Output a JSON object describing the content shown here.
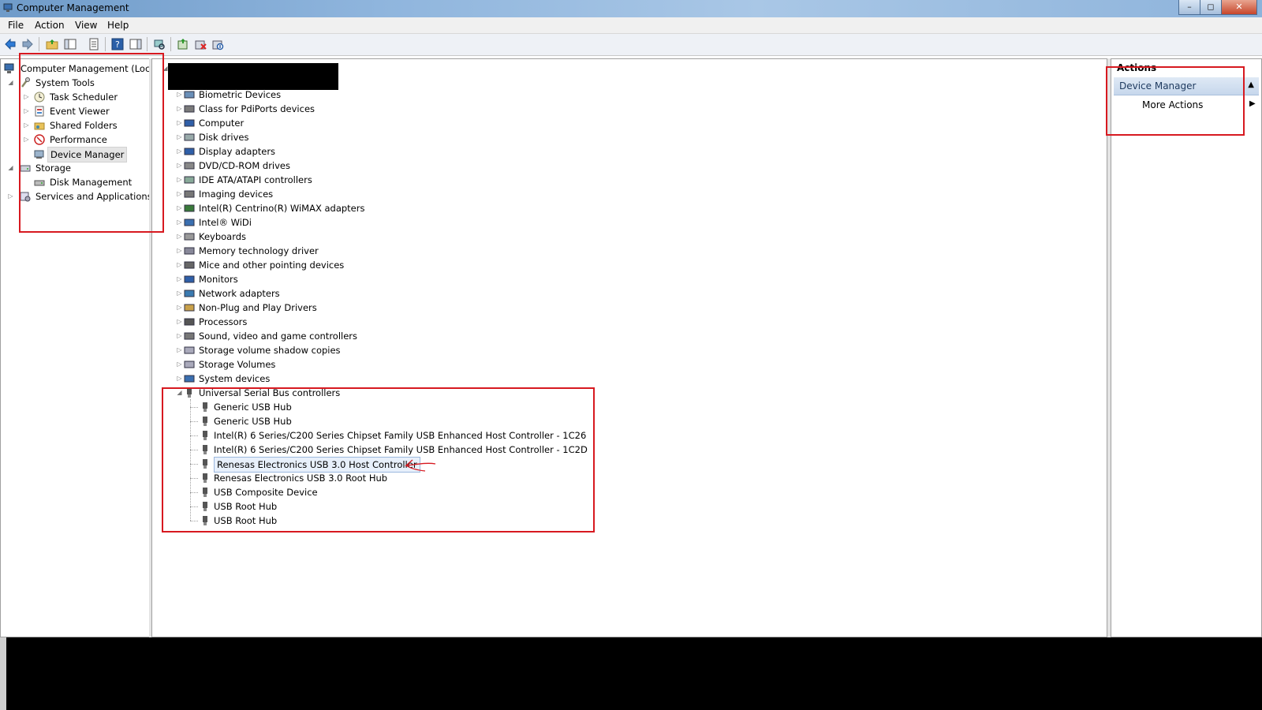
{
  "window": {
    "title": "Computer Management",
    "min": "–",
    "max": "◻",
    "close": "✕"
  },
  "menu": [
    "File",
    "Action",
    "View",
    "Help"
  ],
  "toolbar_icons": [
    "back-arrow-icon",
    "forward-arrow-icon",
    "up-folder-icon",
    "show-hide-tree-icon",
    "properties-icon",
    "help-icon",
    "show-hide-action-pane-icon",
    "scan-hardware-icon",
    "update-driver-icon",
    "uninstall-icon",
    "disable-icon"
  ],
  "left_tree": {
    "root": "Computer Management (Local",
    "system_tools": "System Tools",
    "task_scheduler": "Task Scheduler",
    "event_viewer": "Event Viewer",
    "shared_folders": "Shared Folders",
    "performance": "Performance",
    "device_manager": "Device Manager",
    "storage": "Storage",
    "disk_management": "Disk Management",
    "services": "Services and Applications"
  },
  "device_categories": [
    "Biometric Devices",
    "Class for PdiPorts devices",
    "Computer",
    "Disk drives",
    "Display adapters",
    "DVD/CD-ROM drives",
    "IDE ATA/ATAPI controllers",
    "Imaging devices",
    "Intel(R) Centrino(R) WiMAX adapters",
    "Intel® WiDi",
    "Keyboards",
    "Memory technology driver",
    "Mice and other pointing devices",
    "Monitors",
    "Network adapters",
    "Non-Plug and Play Drivers",
    "Processors",
    "Sound, video and game controllers",
    "Storage volume shadow copies",
    "Storage Volumes",
    "System devices"
  ],
  "usb_category": "Universal Serial Bus controllers",
  "usb_devices": [
    "Generic USB Hub",
    "Generic USB Hub",
    "Intel(R) 6 Series/C200 Series Chipset Family USB Enhanced Host Controller - 1C26",
    "Intel(R) 6 Series/C200 Series Chipset Family USB Enhanced Host Controller - 1C2D",
    "Renesas Electronics USB 3.0 Host Controller",
    "Renesas Electronics USB 3.0 Root Hub",
    "USB Composite Device",
    "USB Root Hub",
    "USB Root Hub"
  ],
  "selected_usb_index": 4,
  "actions": {
    "title": "Actions",
    "section": "Device Manager",
    "more": "More Actions"
  },
  "colors": {
    "annotation_red": "#d71920",
    "selection_blue": "#9cb8de"
  }
}
